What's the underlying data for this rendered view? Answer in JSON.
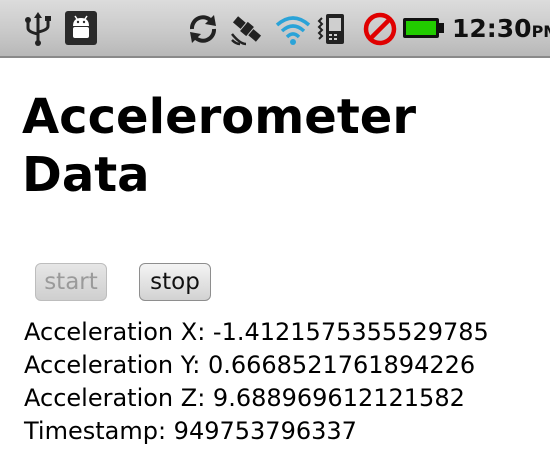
{
  "status_bar": {
    "icons": [
      "usb-icon",
      "android-debug-icon",
      "sync-icon",
      "gps-satellite-icon",
      "wifi-icon",
      "vibrate-icon",
      "no-sim-icon",
      "battery-icon"
    ],
    "time": "12:30",
    "ampm": "PM",
    "battery_color": "#22cc00",
    "no_sim_color": "#e00000",
    "wifi_color": "#2aa3d8"
  },
  "app": {
    "title": "Accelerometer Data"
  },
  "controls": {
    "start_label": "start",
    "start_enabled": false,
    "stop_label": "stop",
    "stop_enabled": true
  },
  "readings": {
    "x": "Acceleration X: -1.4121575355529785",
    "y": "Acceleration Y: 0.6668521761894226",
    "z": "Acceleration Z: 9.688969612121582",
    "timestamp": "Timestamp: 949753796337"
  }
}
